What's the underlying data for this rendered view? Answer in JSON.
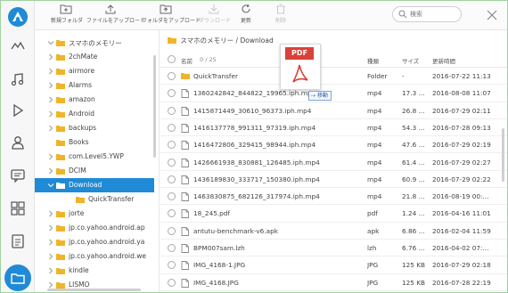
{
  "toolbar": {
    "buttons": [
      {
        "label": "新規フォルダ",
        "icon": "new-folder-icon",
        "enabled": true
      },
      {
        "label": "ファイルをアップロード",
        "icon": "upload-icon",
        "enabled": true
      },
      {
        "label": "フォルダをアップロード",
        "icon": "upload-folder-icon",
        "enabled": true
      },
      {
        "label": "ダウンロード",
        "icon": "download-icon",
        "enabled": false
      },
      {
        "label": "更新",
        "icon": "refresh-icon",
        "enabled": true
      },
      {
        "label": "削除",
        "icon": "delete-icon",
        "enabled": false
      }
    ],
    "search_placeholder": "検索"
  },
  "rail": {
    "items": [
      "home-icon",
      "music-icon",
      "video-icon",
      "contacts-icon",
      "messages-icon",
      "apps-icon",
      "documents-icon",
      "files-icon"
    ],
    "active": "files-icon"
  },
  "tree": {
    "root": "スマホのメモリー",
    "items": [
      {
        "label": "2chMate",
        "expanded": false,
        "selected": false,
        "level": 1
      },
      {
        "label": "airmore",
        "expanded": false,
        "selected": false,
        "level": 1
      },
      {
        "label": "Alarms",
        "expanded": false,
        "selected": false,
        "level": 1
      },
      {
        "label": "amazon",
        "expanded": false,
        "selected": false,
        "level": 1
      },
      {
        "label": "Android",
        "expanded": false,
        "selected": false,
        "level": 1
      },
      {
        "label": "backups",
        "expanded": false,
        "selected": false,
        "level": 1
      },
      {
        "label": "Books",
        "expanded": false,
        "selected": false,
        "level": 1,
        "leaf": true
      },
      {
        "label": "com.Level5.YWP",
        "expanded": false,
        "selected": false,
        "level": 1
      },
      {
        "label": "DCIM",
        "expanded": false,
        "selected": false,
        "level": 1
      },
      {
        "label": "Download",
        "expanded": true,
        "selected": true,
        "level": 1
      },
      {
        "label": "QuickTransfer",
        "expanded": false,
        "selected": false,
        "level": 2,
        "leaf": true
      },
      {
        "label": "jorte",
        "expanded": false,
        "selected": false,
        "level": 1
      },
      {
        "label": "jp.co.yahoo.android.ap",
        "expanded": false,
        "selected": false,
        "level": 1
      },
      {
        "label": "jp.co.yahoo.android.ya",
        "expanded": false,
        "selected": false,
        "level": 1
      },
      {
        "label": "jp.co.yahoo.android.we",
        "expanded": false,
        "selected": false,
        "level": 1
      },
      {
        "label": "kindle",
        "expanded": false,
        "selected": false,
        "level": 1
      },
      {
        "label": "LISMO",
        "expanded": false,
        "selected": false,
        "level": 1
      }
    ]
  },
  "breadcrumb": "スマホのメモリー / Download",
  "list": {
    "columns": {
      "name": "名前",
      "count": "0 / 25",
      "kind": "種類",
      "size": "サイズ",
      "modified": "更新時間"
    },
    "rows": [
      {
        "name": "QuickTransfer",
        "kind": "Folder",
        "size": "-",
        "date": "2016-07-22 11:13",
        "type": "folder"
      },
      {
        "name": "1360242842_844822_19965.iph.mp4",
        "kind": "mp4",
        "size": "17.3 ...",
        "date": "2016-08-08 11:07",
        "type": "file"
      },
      {
        "name": "1415871449_30610_96373.iph.mp4",
        "kind": "mp4",
        "size": "26.8 ...",
        "date": "2016-07-29 02:11",
        "type": "file"
      },
      {
        "name": "1416137778_991311_97319.iph.mp4",
        "kind": "mp4",
        "size": "54.3 ...",
        "date": "2016-07-28 09:13",
        "type": "file"
      },
      {
        "name": "1416472806_329415_98944.iph.mp4",
        "kind": "mp4",
        "size": "47.6 ...",
        "date": "2016-07-29 02:19",
        "type": "file"
      },
      {
        "name": "1426661938_830881_126485.iph.mp4",
        "kind": "mp4",
        "size": "61.4 ...",
        "date": "2016-07-29 02:27",
        "type": "file"
      },
      {
        "name": "1436189830_333717_150380.iph.mp4",
        "kind": "mp4",
        "size": "60.9 ...",
        "date": "2016-07-29 02:22",
        "type": "file"
      },
      {
        "name": "1463830875_682126_317974.iph.mp4",
        "kind": "mp4",
        "size": "21.8 ...",
        "date": "2016-08-19 00:...",
        "type": "file"
      },
      {
        "name": "18_245.pdf",
        "kind": "pdf",
        "size": "1.24 ...",
        "date": "2016-04-16 11:01",
        "type": "file"
      },
      {
        "name": "antutu-benchmark-v6.apk",
        "kind": "apk",
        "size": "6.86 ...",
        "date": "2016-02-04 11:59",
        "type": "file"
      },
      {
        "name": "BPM007sam.lzh",
        "kind": "lzh",
        "size": "6.76 ...",
        "date": "2016-04-02 07:...",
        "type": "file"
      },
      {
        "name": "IMG_4168-1.JPG",
        "kind": "JPG",
        "size": "125 KB",
        "date": "2016-07-29 02:18",
        "type": "file"
      },
      {
        "name": "IMG_4168.JPG",
        "kind": "JPG",
        "size": "125 KB",
        "date": "2016-07-28 22:19",
        "type": "file"
      }
    ]
  },
  "drag": {
    "badge": "PDF",
    "tooltip": "移動"
  },
  "colors": {
    "accent": "#1f8ad6",
    "folder": "#f0b429",
    "pdf_red": "#d9372f"
  }
}
